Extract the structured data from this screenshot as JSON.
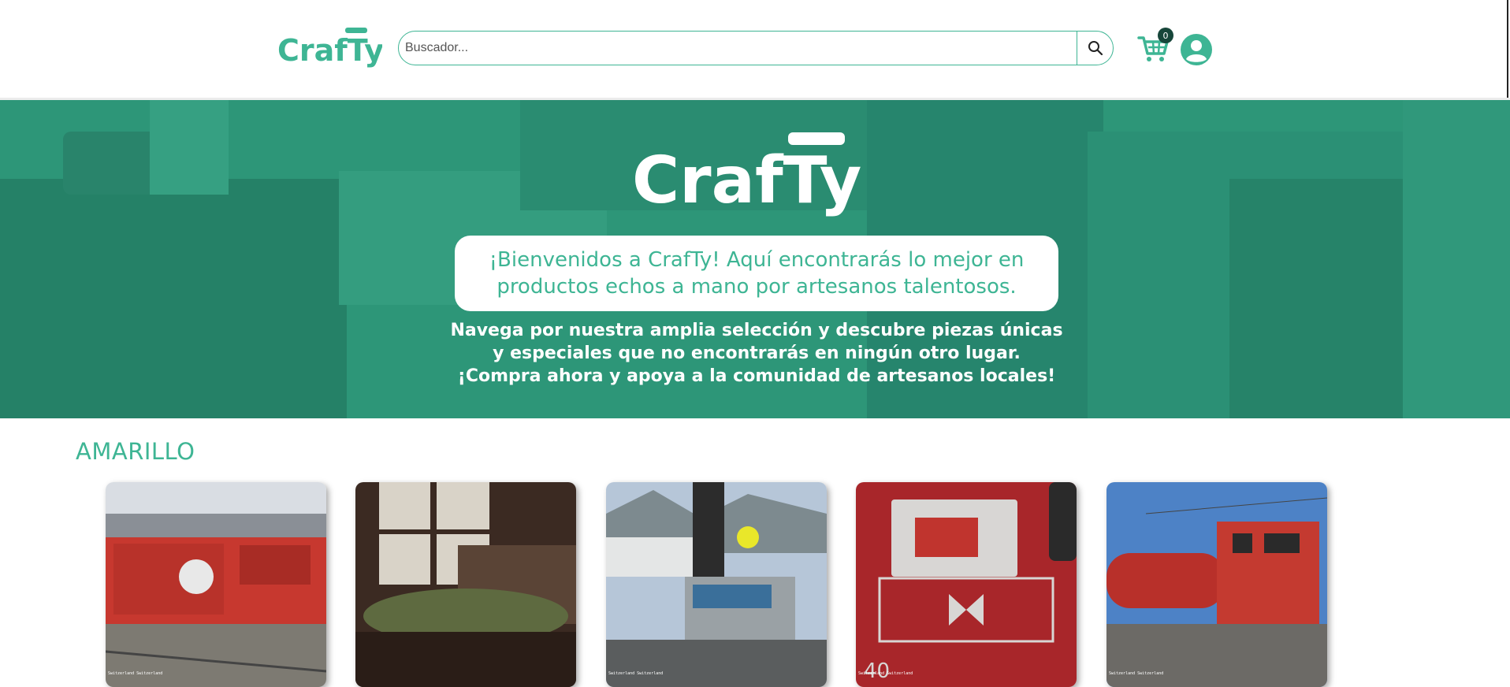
{
  "header": {
    "logo_text": "CrafTy",
    "search": {
      "placeholder": "Buscador...",
      "value": ""
    },
    "search_icon": "search-icon",
    "cart_icon": "cart-icon",
    "cart_count": "0",
    "account_icon": "user-circle-icon"
  },
  "hero": {
    "logo_text": "CrafTy",
    "headline": "¡Bienvenidos a CrafTy! Aquí encontrarás lo mejor en productos echos a mano por artesanos talentosos.",
    "subtext": "Navega por nuestra amplia selección y descubre piezas únicas y especiales que no encontrarás en ningún otro lugar. ¡Compra ahora y apoya a la comunidad de artesanos locales!"
  },
  "section": {
    "title": "AMARILLO",
    "products": [
      {
        "image": "red-rescue-train",
        "watermark": "Switzerland Switzerland"
      },
      {
        "image": "model-railway-blur",
        "watermark": ""
      },
      {
        "image": "train-control-panel",
        "watermark": "Switzerland Switzerland"
      },
      {
        "image": "red-train-door-logo",
        "watermark": "Switzerland Switzerland"
      },
      {
        "image": "red-tank-locomotive",
        "watermark": "Switzerland Switzerland"
      }
    ]
  },
  "colors": {
    "brand": "#3eb594",
    "hero_overlay": "#2c8f74",
    "badge": "#17463a"
  }
}
